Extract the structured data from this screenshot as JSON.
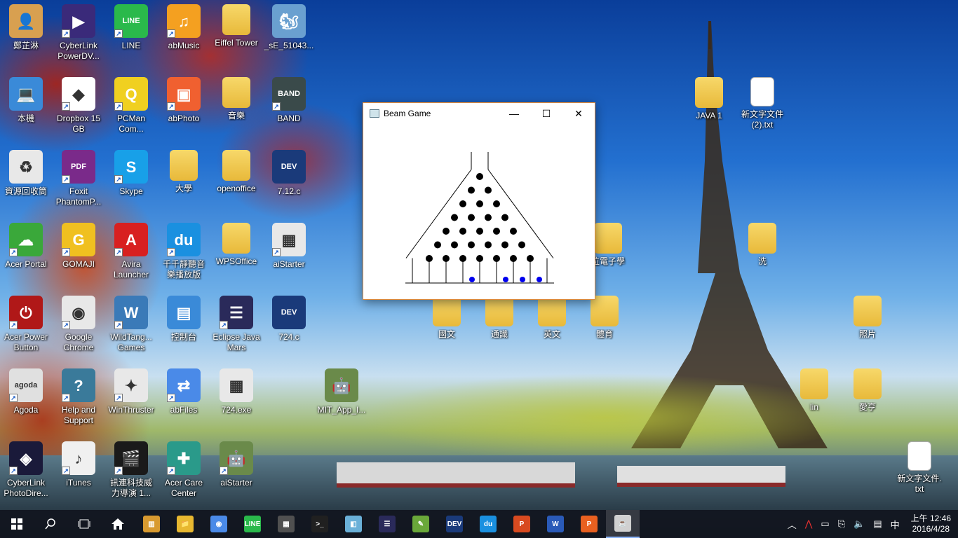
{
  "desktop_icons": [
    {
      "label": "鄭芷淋",
      "color": "#d8a050",
      "glyph": "👤",
      "shortcut": false
    },
    {
      "label": "CyberLink PowerDV...",
      "color": "#3a2a7a",
      "glyph": "▶",
      "shortcut": true
    },
    {
      "label": "LINE",
      "color": "#2ab94b",
      "glyph": "LINE",
      "shortcut": true
    },
    {
      "label": "abMusic",
      "color": "#f4a020",
      "glyph": "♫",
      "shortcut": true
    },
    {
      "label": "Eiffel Tower",
      "color": "folder",
      "glyph": "",
      "shortcut": false
    },
    {
      "label": "_sE_51043...",
      "color": "#6aa0d0",
      "glyph": "🐿",
      "shortcut": false
    },
    {
      "label": "本機",
      "color": "#3a8ad8",
      "glyph": "💻",
      "shortcut": false
    },
    {
      "label": "Dropbox 15 GB",
      "color": "#ffffff",
      "glyph": "◆",
      "shortcut": true
    },
    {
      "label": "PCMan Com...",
      "color": "#f0d020",
      "glyph": "Q",
      "shortcut": true
    },
    {
      "label": "abPhoto",
      "color": "#f06030",
      "glyph": "▣",
      "shortcut": true
    },
    {
      "label": "音樂",
      "color": "folder",
      "glyph": "",
      "shortcut": false
    },
    {
      "label": "BAND",
      "color": "#3a4a4a",
      "glyph": "BAND",
      "shortcut": true
    },
    {
      "label": "資源回收筒",
      "color": "#e8e8e8",
      "glyph": "♻",
      "shortcut": false
    },
    {
      "label": "Foxit PhantomP...",
      "color": "#7a2a8a",
      "glyph": "PDF",
      "shortcut": true
    },
    {
      "label": "Skype",
      "color": "#18a0e8",
      "glyph": "S",
      "shortcut": true
    },
    {
      "label": "大學",
      "color": "folder",
      "glyph": "",
      "shortcut": false
    },
    {
      "label": "openoffice",
      "color": "folder",
      "glyph": "",
      "shortcut": false
    },
    {
      "label": "7.12.c",
      "color": "#1a3a7a",
      "glyph": "DEV",
      "shortcut": false
    },
    {
      "label": "Acer Portal",
      "color": "#3aa83a",
      "glyph": "☁",
      "shortcut": true
    },
    {
      "label": "GOMAJI",
      "color": "#f0c020",
      "glyph": "G",
      "shortcut": true
    },
    {
      "label": "Avira Launcher",
      "color": "#d82020",
      "glyph": "A",
      "shortcut": true
    },
    {
      "label": "千千靜聽音 樂播放版",
      "color": "#1a90e0",
      "glyph": "du",
      "shortcut": true
    },
    {
      "label": "WPSOffice",
      "color": "folder",
      "glyph": "",
      "shortcut": false
    },
    {
      "label": "aiStarter",
      "color": "#e8e8e8",
      "glyph": "▦",
      "shortcut": true
    },
    {
      "label": "Acer Power Button",
      "color": "#b01818",
      "glyph": "⏻",
      "shortcut": true
    },
    {
      "label": "Google Chrome",
      "color": "#e8e8e8",
      "glyph": "◉",
      "shortcut": true
    },
    {
      "label": "WildTang... Games",
      "color": "#3a7ab8",
      "glyph": "W",
      "shortcut": true
    },
    {
      "label": "控制台",
      "color": "#3a8ad8",
      "glyph": "▤",
      "shortcut": false
    },
    {
      "label": "Eclipse Java Mars",
      "color": "#2a2a5a",
      "glyph": "☰",
      "shortcut": true
    },
    {
      "label": "724.c",
      "color": "#1a3a7a",
      "glyph": "DEV",
      "shortcut": false
    },
    {
      "label": "Agoda",
      "color": "#e0e0e0",
      "glyph": "agoda",
      "shortcut": true
    },
    {
      "label": "Help and Support",
      "color": "#3a7a9a",
      "glyph": "?",
      "shortcut": true
    },
    {
      "label": "WinThruster",
      "color": "#e8e8e8",
      "glyph": "✦",
      "shortcut": true
    },
    {
      "label": "abFiles",
      "color": "#4a8ae8",
      "glyph": "⇄",
      "shortcut": true
    },
    {
      "label": "724.exe",
      "color": "#e8e8e8",
      "glyph": "▦",
      "shortcut": false
    },
    {
      "label": "MIT_App_I...",
      "color": "#6a8a4a",
      "glyph": "🤖",
      "shortcut": false
    },
    {
      "label": "CyberLink PhotoDire...",
      "color": "#1a1a3a",
      "glyph": "◈",
      "shortcut": true
    },
    {
      "label": "iTunes",
      "color": "#f0f0f0",
      "glyph": "♪",
      "shortcut": true
    },
    {
      "label": "訊連科技威 力導演 1...",
      "color": "#1a1a1a",
      "glyph": "🎬",
      "shortcut": true
    },
    {
      "label": "Acer Care Center",
      "color": "#2a9a8a",
      "glyph": "✚",
      "shortcut": true
    },
    {
      "label": "aiStarter",
      "color": "#6a8a4a",
      "glyph": "🤖",
      "shortcut": true
    },
    {
      "label": "JAVA 1",
      "color": "folder",
      "glyph": "",
      "shortcut": false
    },
    {
      "label": "新文字文件 (2).txt",
      "color": "doc",
      "glyph": "",
      "shortcut": false
    },
    {
      "label": "位電子學",
      "color": "folder",
      "glyph": "",
      "shortcut": false
    },
    {
      "label": "洗",
      "color": "folder",
      "glyph": "",
      "shortcut": false
    },
    {
      "label": "國文",
      "color": "folder",
      "glyph": "",
      "shortcut": false
    },
    {
      "label": "通識",
      "color": "folder",
      "glyph": "",
      "shortcut": false
    },
    {
      "label": "英文",
      "color": "folder",
      "glyph": "",
      "shortcut": false
    },
    {
      "label": "體育",
      "color": "folder",
      "glyph": "",
      "shortcut": false
    },
    {
      "label": "照片",
      "color": "folder",
      "glyph": "",
      "shortcut": false
    },
    {
      "label": "lin",
      "color": "folder",
      "glyph": "",
      "shortcut": false
    },
    {
      "label": "愛亨",
      "color": "folder",
      "glyph": "",
      "shortcut": false
    },
    {
      "label": "新文字文件. txt",
      "color": "doc",
      "glyph": "",
      "shortcut": false
    }
  ],
  "window": {
    "title": "Beam Game",
    "minimize_glyph": "—",
    "maximize_glyph": "☐",
    "close_glyph": "✕",
    "pegs_rows": 7,
    "slots": 8,
    "balls_in_slots": [
      3,
      5,
      6,
      7
    ]
  },
  "taskbar": {
    "items": [
      {
        "name": "file-manager",
        "glyph": "▥",
        "color": "#d89a30"
      },
      {
        "name": "file-explorer",
        "glyph": "📁",
        "color": "#e8b830"
      },
      {
        "name": "chrome",
        "glyph": "◉",
        "color": "#4a8ae8"
      },
      {
        "name": "line",
        "glyph": "LINE",
        "color": "#2ab94b"
      },
      {
        "name": "calculator",
        "glyph": "▦",
        "color": "#505050"
      },
      {
        "name": "terminal",
        "glyph": ">_",
        "color": "#202020"
      },
      {
        "name": "notes",
        "glyph": "◧",
        "color": "#6ab0d8"
      },
      {
        "name": "eclipse",
        "glyph": "☰",
        "color": "#2a2a5a"
      },
      {
        "name": "editor",
        "glyph": "✎",
        "color": "#6aa83a"
      },
      {
        "name": "dev-cpp",
        "glyph": "DEV",
        "color": "#1a3a7a"
      },
      {
        "name": "music-player",
        "glyph": "du",
        "color": "#1a90e0"
      },
      {
        "name": "powerpoint",
        "glyph": "P",
        "color": "#d84a20"
      },
      {
        "name": "word",
        "glyph": "W",
        "color": "#2a5ab8"
      },
      {
        "name": "wps-presentation",
        "glyph": "P",
        "color": "#e86020"
      },
      {
        "name": "java",
        "glyph": "☕",
        "color": "#d0d0d0"
      }
    ],
    "tray": {
      "ime": "中",
      "time": "上午 12:46",
      "date": "2016/4/28"
    }
  }
}
